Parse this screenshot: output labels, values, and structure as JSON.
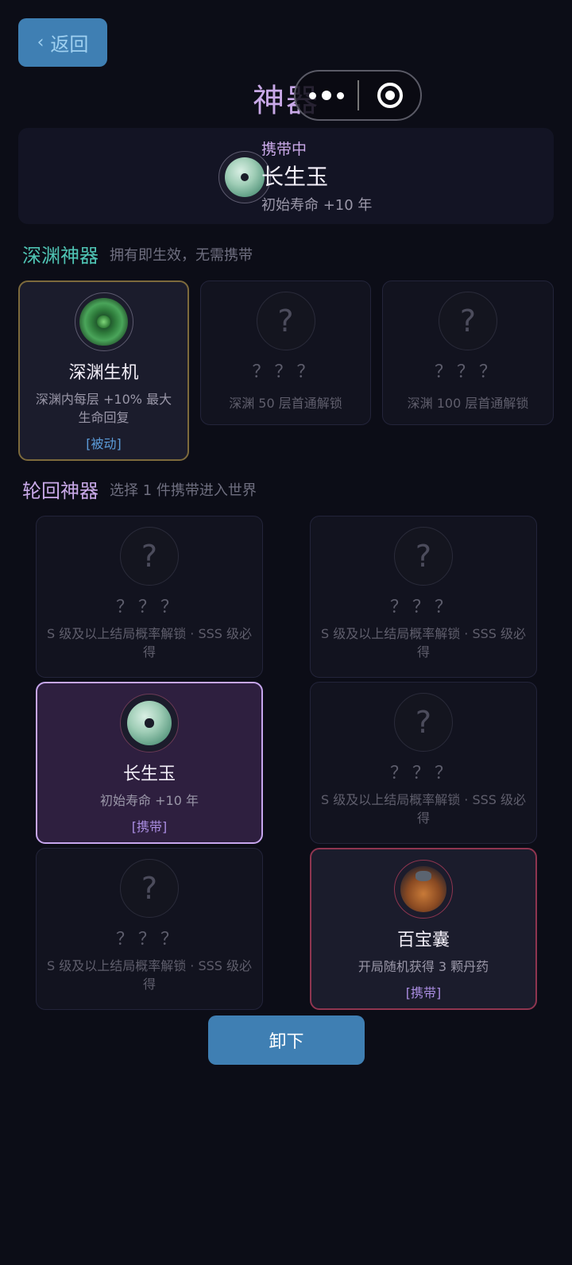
{
  "header": {
    "back_label": "返回",
    "back_icon": "‹",
    "title": "神器"
  },
  "carrying": {
    "status": "携带中",
    "name": "长生玉",
    "desc": "初始寿命 +10 年"
  },
  "abyss": {
    "title": "深渊神器",
    "subtitle": "拥有即生效，无需携带",
    "items": [
      {
        "name": "深渊生机",
        "desc": "深渊内每层 +10% 最大生命回复",
        "tag": "[被动]"
      },
      {
        "name": "？？？",
        "desc": "深渊 50 层首通解锁"
      },
      {
        "name": "？？？",
        "desc": "深渊 100 层首通解锁"
      }
    ]
  },
  "reincarnation": {
    "title": "轮回神器",
    "subtitle": "选择 1 件携带进入世界",
    "items": [
      {
        "name": "？？？",
        "desc": "S 级及以上结局概率解锁 · SSS 级必得"
      },
      {
        "name": "？？？",
        "desc": "S 级及以上结局概率解锁 · SSS 级必得"
      },
      {
        "name": "长生玉",
        "desc": "初始寿命 +10 年",
        "tag": "[携带]"
      },
      {
        "name": "？？？",
        "desc": "S 级及以上结局概率解锁 · SSS 级必得"
      },
      {
        "name": "？？？",
        "desc": "S 级及以上结局概率解锁 · SSS 级必得"
      },
      {
        "name": "百宝囊",
        "desc": "开局随机获得 3 颗丹药",
        "tag": "[携带]"
      }
    ]
  },
  "locked_symbol": "?",
  "unload_label": "卸下",
  "colors": {
    "abyss_title": "#4fc4b4",
    "reincarnation_title": "#c9a9e8",
    "passive_tag": "#5b9bd8",
    "carry_tag": "#a98ce0",
    "button": "#3f7fb3"
  }
}
